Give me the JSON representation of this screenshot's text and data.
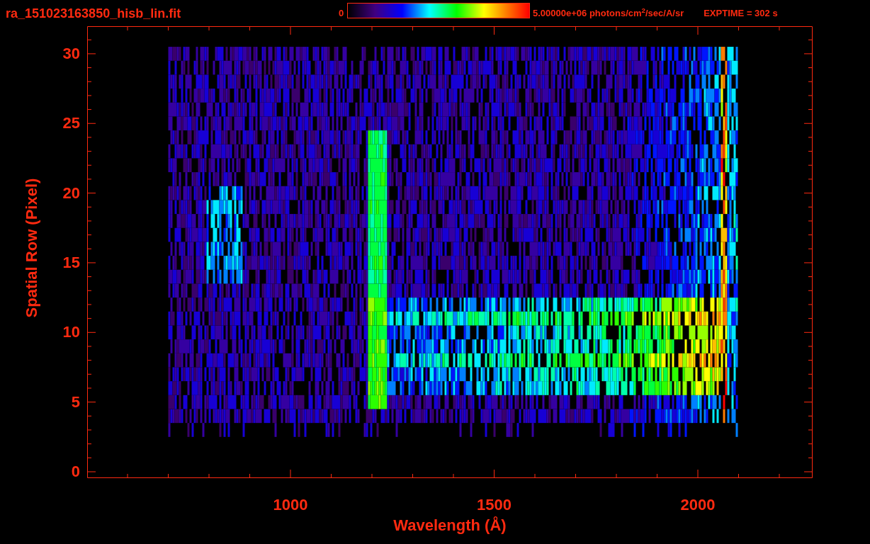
{
  "title": "ra_151023163850_hisb_lin.fit",
  "colorbar": {
    "min_label": "0",
    "max_label": "5.00000e+06 photons/cm$^{2}$/sec/A/sr"
  },
  "exposure": "EXPTIME = 302 s",
  "y_axis": {
    "label": "Spatial Row (Pixel)",
    "ticks": [
      "30",
      "25",
      "20",
      "15",
      "10",
      "5",
      "0"
    ]
  },
  "x_axis": {
    "label": "Wavelength (Å)",
    "ticks": [
      "1000",
      "1500",
      "2000"
    ]
  }
}
